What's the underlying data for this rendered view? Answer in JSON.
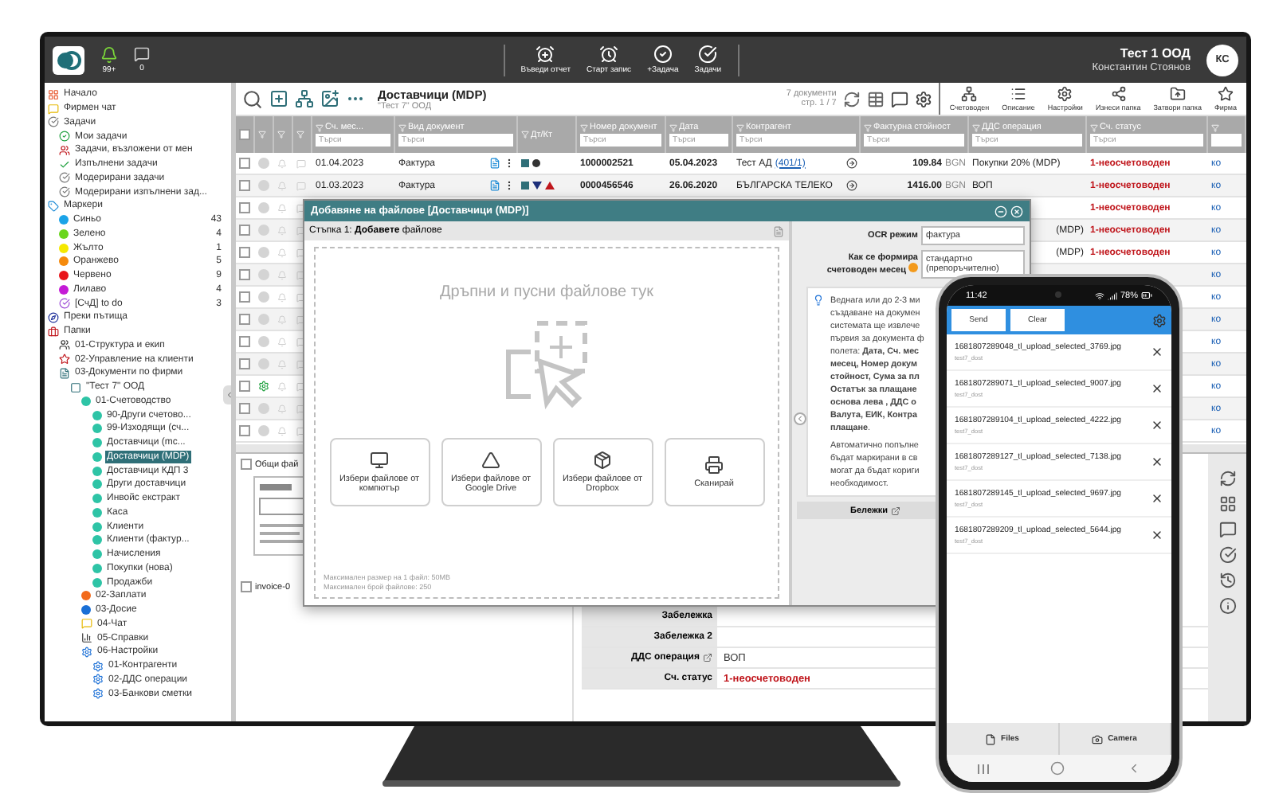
{
  "topbar": {
    "notifications": "99+",
    "messages": "0",
    "actions": [
      {
        "label": "Въведи отчет",
        "kind": "report"
      },
      {
        "label": "Старт запис",
        "kind": "record"
      },
      {
        "label": "+Задача",
        "kind": "add-task"
      },
      {
        "label": "Задачи",
        "kind": "tasks"
      }
    ],
    "company": "Тест 1 ООД",
    "user": "Константин Стоянов",
    "initials": "КС"
  },
  "sidebar": {
    "items": [
      {
        "label": "Начало",
        "kind": "home",
        "selected": false
      },
      {
        "label": "Фирмен чат",
        "kind": "chat",
        "selected": false
      },
      {
        "label": "Задачи",
        "kind": "tasks",
        "selected": false,
        "children": [
          {
            "label": "Мои задачи",
            "kind": "mine",
            "selected": false
          },
          {
            "label": "Задачи, възложени от мен",
            "kind": "assigned",
            "selected": false
          },
          {
            "label": "Изпълнени задачи",
            "kind": "done",
            "selected": false
          },
          {
            "label": "Модерирани задачи",
            "kind": "moderated",
            "selected": false
          },
          {
            "label": "Модерирани изпълнени зад...",
            "kind": "moderated",
            "selected": false
          }
        ]
      },
      {
        "label": "Маркери",
        "kind": "markers",
        "selected": false,
        "children": [
          {
            "label": "Синьо",
            "kind": "dot",
            "color": "#1aa3e8",
            "count": "43",
            "selected": false
          },
          {
            "label": "Зелено",
            "kind": "dot",
            "color": "#6ad61e",
            "count": "4",
            "selected": false
          },
          {
            "label": "Жълто",
            "kind": "dot",
            "color": "#f5e800",
            "count": "1",
            "selected": false
          },
          {
            "label": "Оранжево",
            "kind": "dot",
            "color": "#f58a0c",
            "count": "5",
            "selected": false
          },
          {
            "label": "Червено",
            "kind": "dot",
            "color": "#e8141a",
            "count": "9",
            "selected": false
          },
          {
            "label": "Лилаво",
            "kind": "dot",
            "color": "#c41ad6",
            "count": "4",
            "selected": false
          },
          {
            "label": "[СчД] to do",
            "kind": "todo",
            "count": "3",
            "selected": false
          }
        ]
      },
      {
        "label": "Преки пътища",
        "kind": "shortcuts",
        "selected": false
      },
      {
        "label": "Папки",
        "kind": "folders",
        "selected": false,
        "children": [
          {
            "label": "01-Структура и екип",
            "kind": "team",
            "selected": false
          },
          {
            "label": "02-Управление на клиенти",
            "kind": "clients",
            "selected": false
          },
          {
            "label": "03-Документи по фирми",
            "kind": "docs",
            "selected": false,
            "children": [
              {
                "label": "\"Тест 7\" ООД",
                "kind": "company",
                "selected": false,
                "children": [
                  {
                    "label": "01-Счетоводство",
                    "kind": "dot",
                    "color": "#2ec4a6",
                    "selected": false,
                    "children": [
                      {
                        "label": "90-Други счетово...",
                        "kind": "dot",
                        "color": "#2ec4a6",
                        "selected": false
                      },
                      {
                        "label": "99-Изходящи (сч...",
                        "kind": "dot",
                        "color": "#2ec4a6",
                        "selected": false
                      },
                      {
                        "label": "Доставчици (mc...",
                        "kind": "dot",
                        "color": "#2ec4a6",
                        "selected": false
                      },
                      {
                        "label": "Доставчици (MDP)",
                        "kind": "dot",
                        "color": "#2ec4a6",
                        "selected": true
                      },
                      {
                        "label": "Доставчици КДП 3",
                        "kind": "dot",
                        "color": "#2ec4a6",
                        "selected": false
                      },
                      {
                        "label": "Други доставчици",
                        "kind": "dot",
                        "color": "#2ec4a6",
                        "selected": false
                      },
                      {
                        "label": "Инвойс екстракт",
                        "kind": "dot",
                        "color": "#2ec4a6",
                        "selected": false
                      },
                      {
                        "label": "Каса",
                        "kind": "dot",
                        "color": "#2ec4a6",
                        "selected": false
                      },
                      {
                        "label": "Клиенти",
                        "kind": "dot",
                        "color": "#2ec4a6",
                        "selected": false
                      },
                      {
                        "label": "Клиенти (фактур...",
                        "kind": "dot",
                        "color": "#2ec4a6",
                        "selected": false
                      },
                      {
                        "label": "Начисления",
                        "kind": "dot",
                        "color": "#2ec4a6",
                        "selected": false
                      },
                      {
                        "label": "Покупки (нова)",
                        "kind": "dot",
                        "color": "#2ec4a6",
                        "selected": false
                      },
                      {
                        "label": "Продажби",
                        "kind": "dot",
                        "color": "#2ec4a6",
                        "selected": false
                      }
                    ]
                  },
                  {
                    "label": "02-Заплати",
                    "kind": "dot",
                    "color": "#f26a1b",
                    "selected": false
                  },
                  {
                    "label": "03-Досие",
                    "kind": "dot",
                    "color": "#1a6fd6",
                    "selected": false
                  },
                  {
                    "label": "04-Чат",
                    "kind": "chat",
                    "selected": false
                  },
                  {
                    "label": "05-Справки",
                    "kind": "chart",
                    "selected": false
                  },
                  {
                    "label": "06-Настройки",
                    "kind": "gear",
                    "selected": false,
                    "children": [
                      {
                        "label": "01-Контрагенти",
                        "kind": "gear",
                        "selected": false
                      },
                      {
                        "label": "02-ДДС операции",
                        "kind": "gear",
                        "selected": false
                      },
                      {
                        "label": "03-Банкови сметки",
                        "kind": "gear",
                        "selected": false
                      }
                    ]
                  }
                ]
              }
            ]
          }
        ]
      }
    ]
  },
  "toolbar": {
    "title": "Доставчици (MDP)",
    "subtitle": "\"Тест 7\" ООД",
    "doc_count": "7 документи",
    "page": "стр. 1 / 7",
    "actions": [
      {
        "label": "Счетоводен",
        "kind": "accounting"
      },
      {
        "label": "Описание",
        "kind": "list"
      },
      {
        "label": "Настройки",
        "kind": "settings"
      },
      {
        "label": "Изнеси папка",
        "kind": "export"
      },
      {
        "label": "Затвори папка",
        "kind": "upload"
      },
      {
        "label": "Фирма",
        "kind": "company"
      }
    ]
  },
  "table": {
    "select_all": false,
    "columns": [
      {
        "label": "Сч. мес...",
        "placeholder": "Търси"
      },
      {
        "label": "Вид документ",
        "placeholder": "Търси"
      },
      {
        "label": "Дт/Кт"
      },
      {
        "label": "Номер документ",
        "placeholder": "Търси"
      },
      {
        "label": "Дата",
        "placeholder": "Търси"
      },
      {
        "label": "Контрагент",
        "placeholder": "Търси"
      },
      {
        "label": "Фактурна стойност",
        "placeholder": "Търси"
      },
      {
        "label": "ДДС операция",
        "placeholder": "Търси"
      },
      {
        "label": "Сч. статус",
        "placeholder": "Търси"
      }
    ],
    "rows": [
      {
        "checked": false,
        "month": "01.04.2023",
        "doc_type": "Фактура",
        "dt_kt": [
          {
            "kind": "square"
          },
          {
            "kind": "dot"
          }
        ],
        "number": "1000002521",
        "date": "05.04.2023",
        "contragent": "Тест АД",
        "contragent_code": "(401/1)",
        "amount": "109.84",
        "currency": "BGN",
        "vat": "Покупки 20% (MDP)",
        "status": "1-неосчетоводен",
        "extra": "ко"
      },
      {
        "checked": false,
        "month": "01.03.2023",
        "doc_type": "Фактура",
        "dt_kt": [
          {
            "kind": "square"
          },
          {
            "kind": "down"
          },
          {
            "kind": "up"
          }
        ],
        "number": "0000456546",
        "date": "26.06.2020",
        "contragent": "БЪЛГАРСКА ТЕЛЕКО",
        "amount": "1416.00",
        "currency": "BGN",
        "vat": "ВОП",
        "status": "1-неосчетоводен",
        "extra": "ко"
      },
      {
        "checked": false,
        "status": "1-неосчетоводен",
        "extra": "ко"
      },
      {
        "checked": false,
        "vat": "(MDP)",
        "status": "1-неосчетоводен",
        "extra": "ко"
      },
      {
        "checked": false,
        "vat": "(MDP)",
        "status": "1-неосчетоводен",
        "extra": "ко"
      },
      {
        "checked": false,
        "extra": "ко"
      },
      {
        "checked": false,
        "extra": "ко"
      },
      {
        "checked": false,
        "extra": "ко"
      },
      {
        "checked": false,
        "extra": "ко"
      },
      {
        "checked": false,
        "extra": "ко"
      },
      {
        "checked": false,
        "status_marker": {
          "kind": "gear"
        },
        "extra": "ко"
      },
      {
        "checked": false,
        "extra": "ко"
      },
      {
        "checked": false,
        "extra": "ко"
      }
    ]
  },
  "files": {
    "label": "Общи фай",
    "checked": false,
    "file": {
      "name": "invoice-0",
      "checked": false
    }
  },
  "details": [
    {
      "label": "Забележка",
      "kind": "plain"
    },
    {
      "label": "Забележка 2",
      "kind": "plain"
    },
    {
      "label": "ДДС операция",
      "kind": "edit",
      "value": "ВОП"
    },
    {
      "label": "Сч. статус",
      "kind": "status",
      "value": "1-неосчетоводен"
    }
  ],
  "dialog": {
    "title": "Добавяне на файлове [Доставчици (MDP)]",
    "step": "Стъпка 1: **Добавете** файлове",
    "drop_hint": "Дръпни и пусни файлове тук",
    "sources": [
      {
        "label": "Избери файлове от компютър",
        "kind": "computer"
      },
      {
        "label": "Избери файлове от Google Drive",
        "kind": "drive"
      },
      {
        "label": "Избери файлове от Dropbox",
        "kind": "dropbox"
      },
      {
        "label": "Сканирай",
        "kind": "scan"
      }
    ],
    "limits": [
      "Максимален размер на 1 файл: 50MB",
      "Максимален брой файлове: 250"
    ],
    "ocr_label": "OCR режим",
    "ocr_value": "фактура",
    "month_label": "Как се формира счетоводен месец",
    "month_value": "стандартно (препоръчително)",
    "info_paragraphs": [
      [
        "Веднага или до 2-3 ми",
        "създаване на докумен",
        "системата ще извлече",
        "първия за документа ф",
        "полета: **Дата, Сч. мес**",
        "**месец, Номер докум**",
        "**стойност, Сума за пл**",
        "**Остатък за плащане**",
        "**основа лева , ДДС о**",
        "**Валута, ЕИК, Контра**",
        "**плащане**."
      ],
      [
        "Автоматично попълне",
        "бъдат маркирани в св",
        "могат да бъдат кориги",
        "необходимост."
      ]
    ],
    "notes_label": "Бележки"
  },
  "phone": {
    "time": "11:42",
    "battery": "78%",
    "send": "Send",
    "clear": "Clear",
    "files": [
      {
        "name": "1681807289048_tl_upload_selected_3769.jpg",
        "folder": "test7_dost"
      },
      {
        "name": "1681807289071_tl_upload_selected_9007.jpg",
        "folder": "test7_dost"
      },
      {
        "name": "1681807289104_tl_upload_selected_4222.jpg",
        "folder": "test7_dost"
      },
      {
        "name": "1681807289127_tl_upload_selected_7138.jpg",
        "folder": "test7_dost"
      },
      {
        "name": "1681807289145_tl_upload_selected_9697.jpg",
        "folder": "test7_dost"
      },
      {
        "name": "1681807289209_tl_upload_selected_5644.jpg",
        "folder": "test7_dost"
      }
    ],
    "tabs": [
      {
        "label": "Files",
        "kind": "files"
      },
      {
        "label": "Camera",
        "kind": "camera"
      }
    ]
  }
}
